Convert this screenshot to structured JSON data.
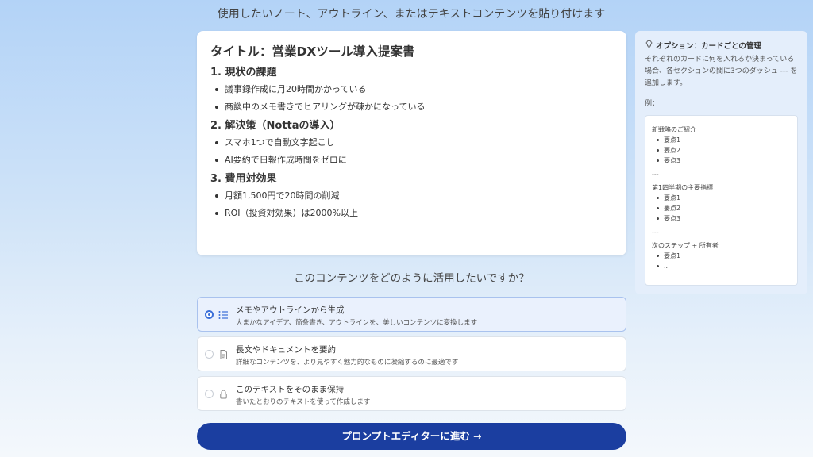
{
  "header": {
    "heading": "使用したいノート、アウトライン、またはテキストコンテンツを貼り付けます"
  },
  "editor": {
    "title": "タイトル：営業DXツール導入提案書",
    "sections": [
      {
        "heading": "1. 現状の課題",
        "items": [
          "議事録作成に月20時間かかっている",
          "商談中のメモ書きでヒアリングが疎かになっている"
        ]
      },
      {
        "heading": "2. 解決策（Nottaの導入）",
        "items": [
          "スマホ1つで自動文字起こし",
          "AI要約で日報作成時間をゼロに"
        ]
      },
      {
        "heading": "3. 費用対効果",
        "items": [
          "月額1,500円で20時間の削減",
          "ROI（投資対効果）は2000%以上"
        ]
      }
    ]
  },
  "question": "このコンテンツをどのように活用したいですか？",
  "options": [
    {
      "title": "メモやアウトラインから生成",
      "desc": "大まかなアイデア、箇条書き、アウトラインを、美しいコンテンツに変換します",
      "icon": "list-icon",
      "selected": true
    },
    {
      "title": "長文やドキュメントを要約",
      "desc": "詳細なコンテンツを、より見やすく魅力的なものに凝縮するのに最適です",
      "icon": "document-icon",
      "selected": false
    },
    {
      "title": "このテキストをそのまま保持",
      "desc": "書いたとおりのテキストを使って作成します",
      "icon": "lock-icon",
      "selected": false
    }
  ],
  "submit": {
    "label": "プロンプトエディターに進む →"
  },
  "side": {
    "title": "オプション：カードごとの管理",
    "text": "それぞれのカードに何を入れるか決まっている場合、各セクションの間に3つのダッシュ --- を追加します。",
    "example_label": "例：",
    "example": {
      "blocks": [
        {
          "title": "新戦略のご紹介",
          "items": [
            "要点1",
            "要点2",
            "要点3"
          ]
        },
        {
          "title": "第1四半期の主要指標",
          "items": [
            "要点1",
            "要点2",
            "要点3"
          ]
        },
        {
          "title": "次のステップ + 所有者",
          "items": [
            "要点1",
            "..."
          ]
        }
      ],
      "separator": "---"
    }
  },
  "colors": {
    "accent": "#1b3ea0",
    "radio_selected": "#3b6fd8",
    "selected_bg": "#eaf1fd"
  }
}
